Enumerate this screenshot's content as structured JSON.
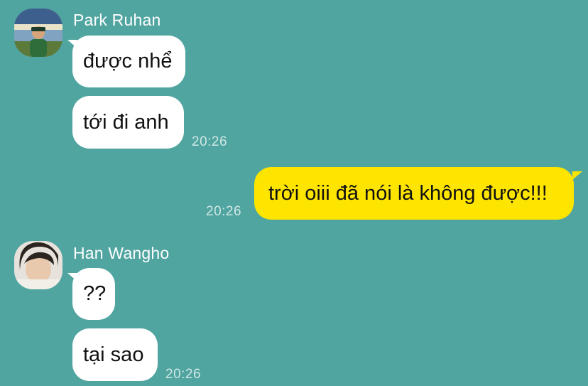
{
  "colors": {
    "background": "#50a5a0",
    "incoming_bubble": "#ffffff",
    "outgoing_bubble": "#fee500",
    "timestamp": "#cfe6e4"
  },
  "groups": [
    {
      "sender": "Park Ruhan",
      "avatar_icon": "profile-photo",
      "messages": [
        "được nhể",
        "tới đi anh"
      ],
      "time": "20:26"
    },
    {
      "outgoing": true,
      "messages": [
        "trời oiii đã nói là không được!!!"
      ],
      "time": "20:26"
    },
    {
      "sender": "Han Wangho",
      "avatar_icon": "profile-photo",
      "messages": [
        "??",
        "tại sao"
      ],
      "time": "20:26"
    }
  ]
}
